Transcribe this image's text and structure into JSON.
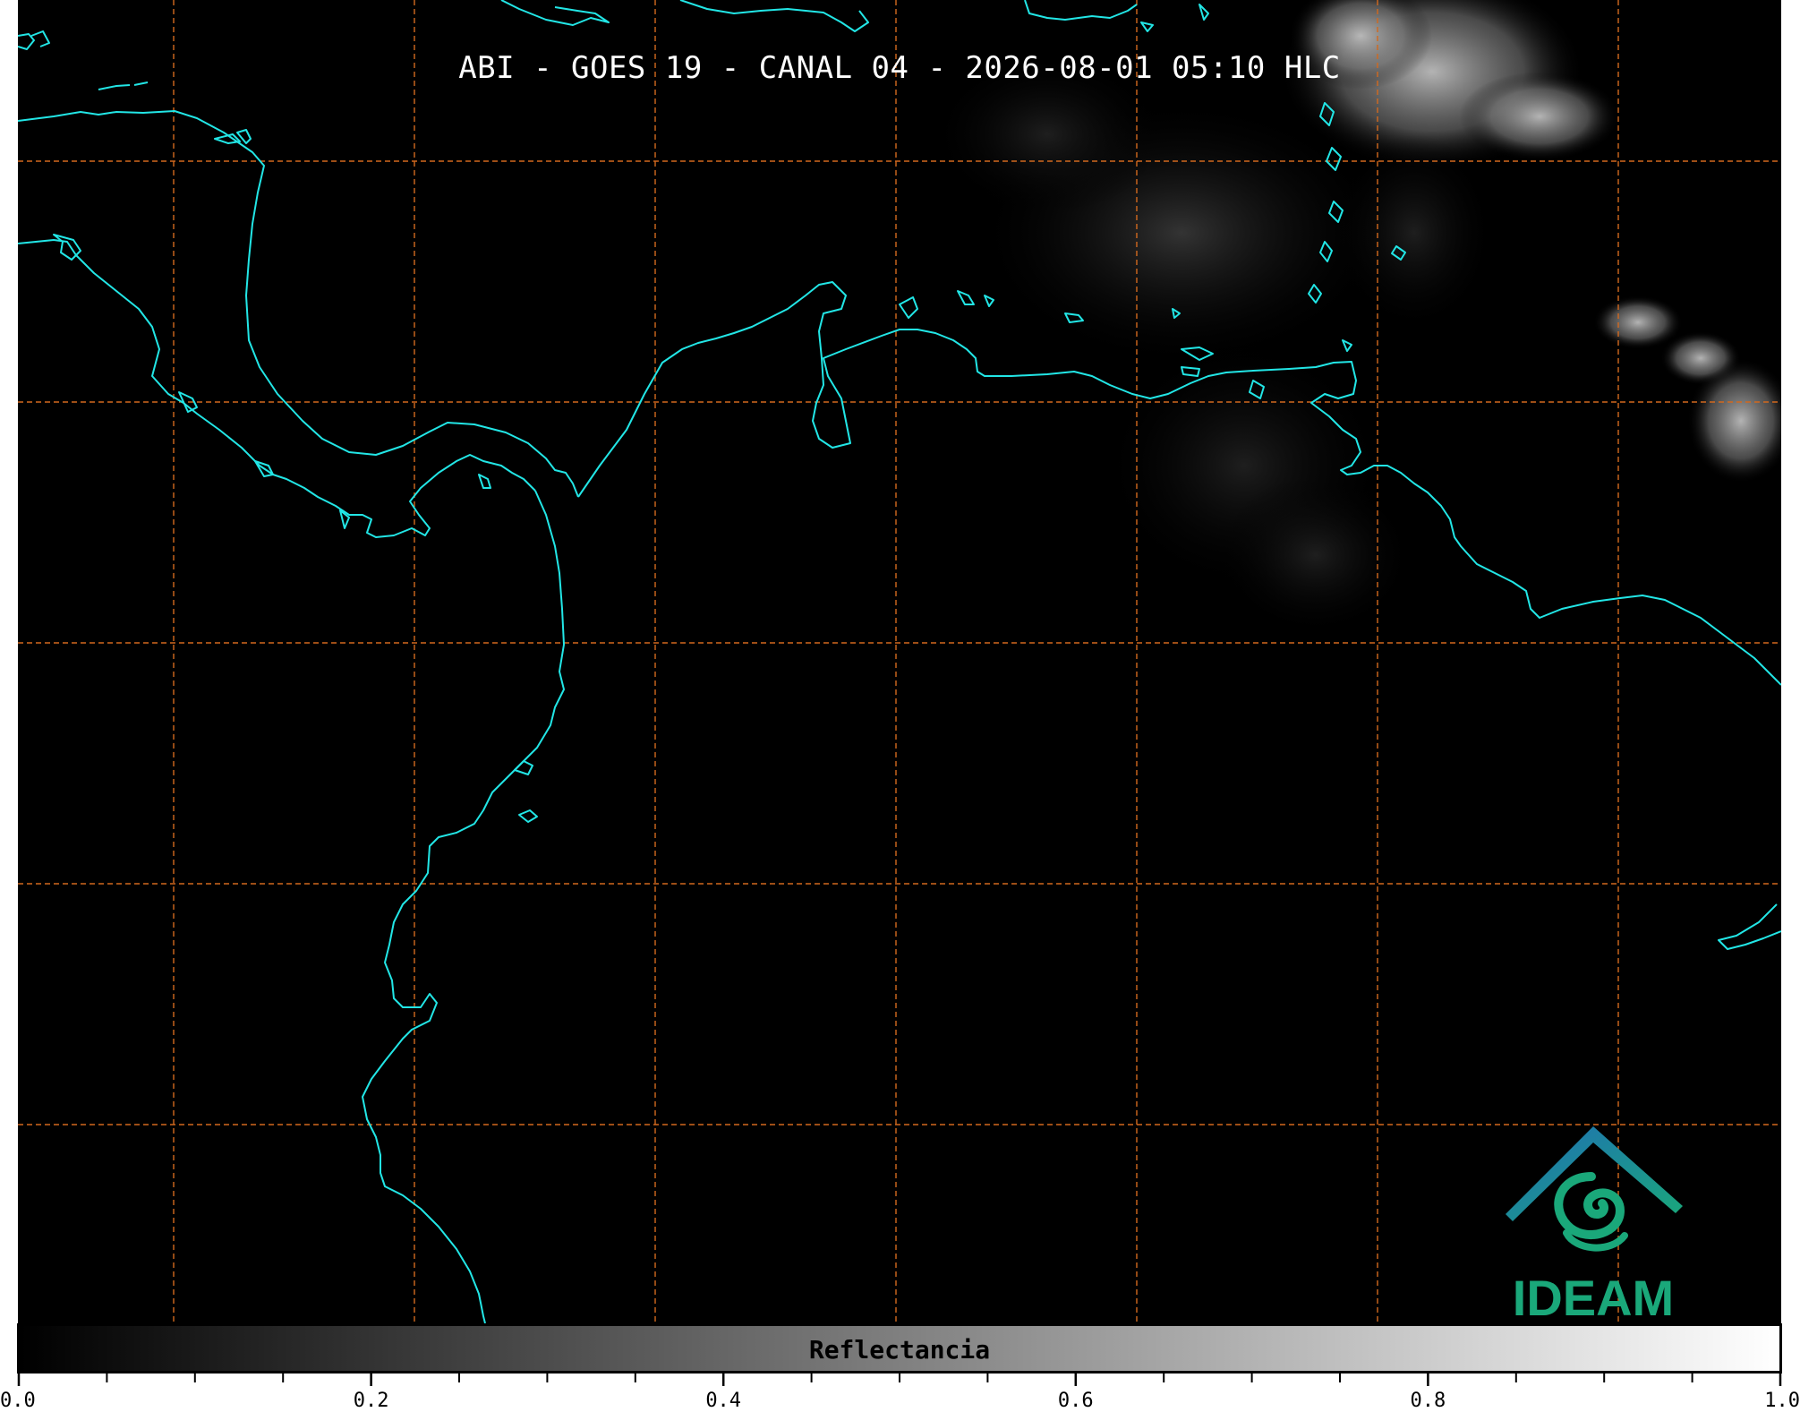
{
  "title": "ABI - GOES 19 - CANAL 04 - 2026-08-01 05:10 HLC",
  "colors": {
    "background": "#000000",
    "coastline": "#22e6e6",
    "grid": "#d2691e",
    "logo_blue": "#1f6fb5",
    "logo_green": "#1aa87a"
  },
  "map": {
    "grid": true,
    "grid_style": "dashed",
    "layers": [
      "satellite-reflectance",
      "coastlines",
      "lat-lon-grid"
    ]
  },
  "logo": {
    "text": "IDEAM"
  },
  "colorbar": {
    "label": "Reflectancia",
    "min": 0.0,
    "max": 1.0,
    "colormap": "gray",
    "tick_labels": [
      "0.0",
      "0.2",
      "0.4",
      "0.6",
      "0.8",
      "1.0"
    ],
    "tick_values": [
      0.0,
      0.2,
      0.4,
      0.6,
      0.8,
      1.0
    ],
    "minor_tick_step": 0.05
  }
}
